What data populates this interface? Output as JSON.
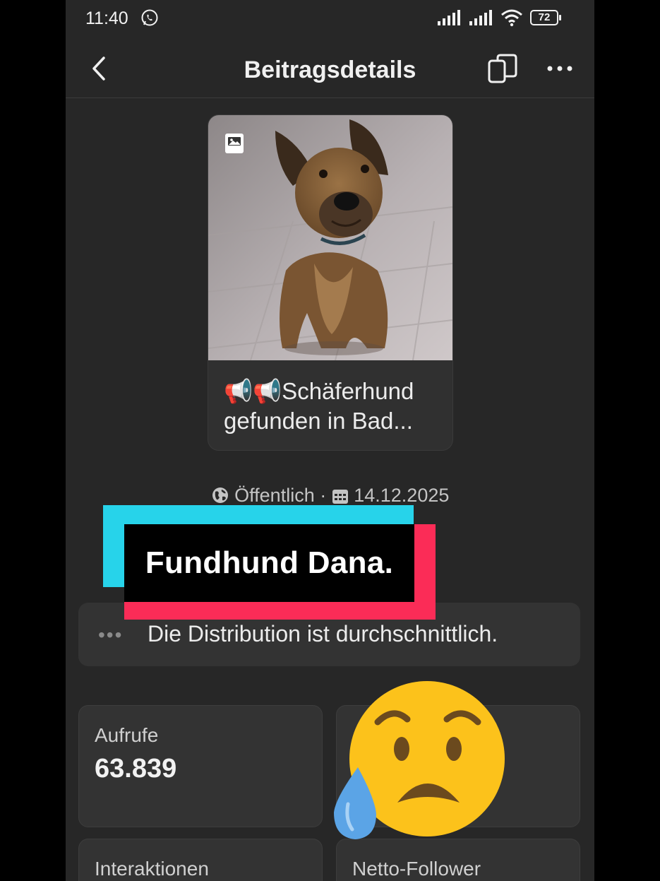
{
  "status_bar": {
    "time": "11:40",
    "battery": "72"
  },
  "header": {
    "title": "Beitragsdetails"
  },
  "post": {
    "caption_line1": "📢📢Schäferhund",
    "caption_line2": "gefunden in Bad..."
  },
  "meta": {
    "visibility": "Öffentlich",
    "separator": " · ",
    "date": "14.12.2025"
  },
  "overlay": {
    "text": "Fundhund Dana."
  },
  "distribution": {
    "text": "Die Distribution ist durchschnittlich."
  },
  "stats": [
    {
      "label": "Aufrufe",
      "value": "63.839"
    },
    {
      "label": "Interaktionen"
    },
    {
      "label": "Netto-Follower"
    }
  ],
  "colors": {
    "overlay_cyan": "#27d3ea",
    "overlay_red": "#fb2c57",
    "background": "#272727"
  }
}
